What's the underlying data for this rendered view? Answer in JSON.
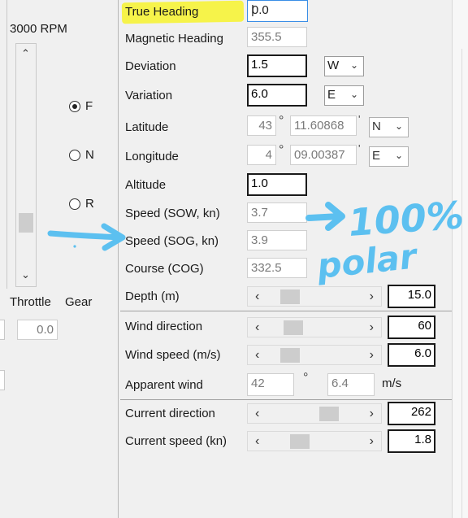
{
  "left_panel": {
    "rpm_label": "3000 RPM",
    "throttle_label": "Throttle",
    "gear_label": "Gear",
    "throttle_value": "0.0",
    "gear_options": [
      "F",
      "N",
      "R"
    ],
    "gear_selected": "F"
  },
  "form": {
    "true_heading": {
      "label": "True Heading",
      "value": "0.0",
      "caret": "|"
    },
    "magnetic_heading": {
      "label": "Magnetic Heading",
      "value": "355.5"
    },
    "deviation": {
      "label": "Deviation",
      "value": "1.5",
      "dir": "W"
    },
    "variation": {
      "label": "Variation",
      "value": "6.0",
      "dir": "E"
    },
    "latitude": {
      "label": "Latitude",
      "deg": "43",
      "deg_sym": "°",
      "min": "11.60868",
      "min_sym": "'",
      "hemi": "N"
    },
    "longitude": {
      "label": "Longitude",
      "deg": "4",
      "deg_sym": "°",
      "min": "09.00387",
      "min_sym": "'",
      "hemi": "E"
    },
    "altitude": {
      "label": "Altitude",
      "value": "1.0"
    },
    "speed_sow": {
      "label": "Speed (SOW, kn)",
      "value": "3.7"
    },
    "speed_sog": {
      "label": "Speed (SOG, kn)",
      "value": "3.9"
    },
    "course": {
      "label": "Course (COG)",
      "value": "332.5"
    },
    "depth": {
      "label": "Depth (m)",
      "value": "15.0",
      "slider_level": 0.13
    },
    "wind_direction": {
      "label": "Wind direction",
      "value": "60",
      "slider_level": 0.17
    },
    "wind_speed": {
      "label": "Wind speed (m/s)",
      "value": "6.0",
      "slider_level": 0.13
    },
    "apparent_wind": {
      "label": "Apparent wind",
      "angle": "42",
      "deg_sym": "°",
      "speed": "6.4",
      "unit": "m/s"
    },
    "current_direction": {
      "label": "Current direction",
      "value": "262",
      "slider_level": 0.73
    },
    "current_speed": {
      "label": "Current speed (kn)",
      "value": "1.8",
      "slider_level": 0.27
    }
  },
  "annotations": {
    "handwritten_line1": "100%",
    "handwritten_line2": "polar",
    "highlight_color": "#f6f34a",
    "ink_color": "#5cc0f0"
  }
}
